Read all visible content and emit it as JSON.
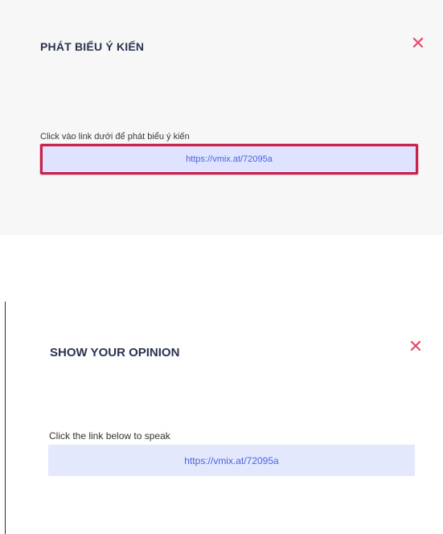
{
  "top_dialog": {
    "title": "PHÁT BIỂU Ý KIẾN",
    "close_glyph": "✕",
    "close_icon": "close-icon",
    "instruction": "Click vào link dưới để phát biểu ý kiến",
    "link": "https://vmix.at/72095a"
  },
  "bottom_dialog": {
    "title": "SHOW YOUR OPINION",
    "close_glyph": "✕",
    "close_icon": "close-icon",
    "instruction": "Click the link below to speak",
    "link": "https://vmix.at/72095a"
  },
  "colors": {
    "title": "#2b3350",
    "close": "#e8476a",
    "link_text": "#4a64e0",
    "link_bg": "#e4e8fc",
    "highlight_border": "#c8214a"
  }
}
